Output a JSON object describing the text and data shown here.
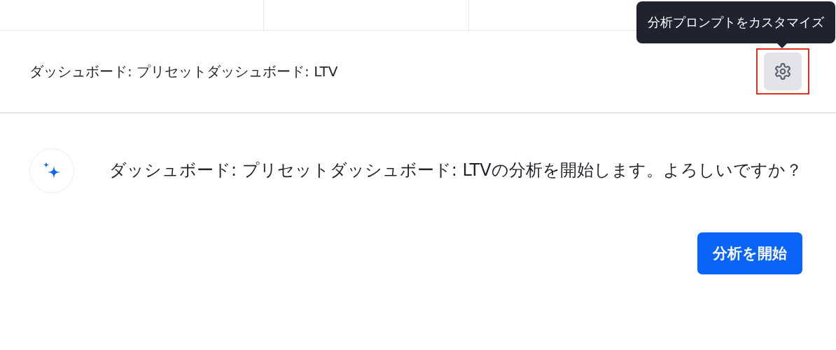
{
  "header": {
    "title": "ダッシュボード: プリセットダッシュボード: LTV",
    "settings_button": {
      "tooltip": "分析プロンプトをカスタマイズ",
      "highlighted": true
    }
  },
  "message": {
    "text": "ダッシュボード: プリセットダッシュボード: LTVの分析を開始します。よろしいですか？"
  },
  "buttons": [
    {
      "label": "分析を開始"
    }
  ]
}
